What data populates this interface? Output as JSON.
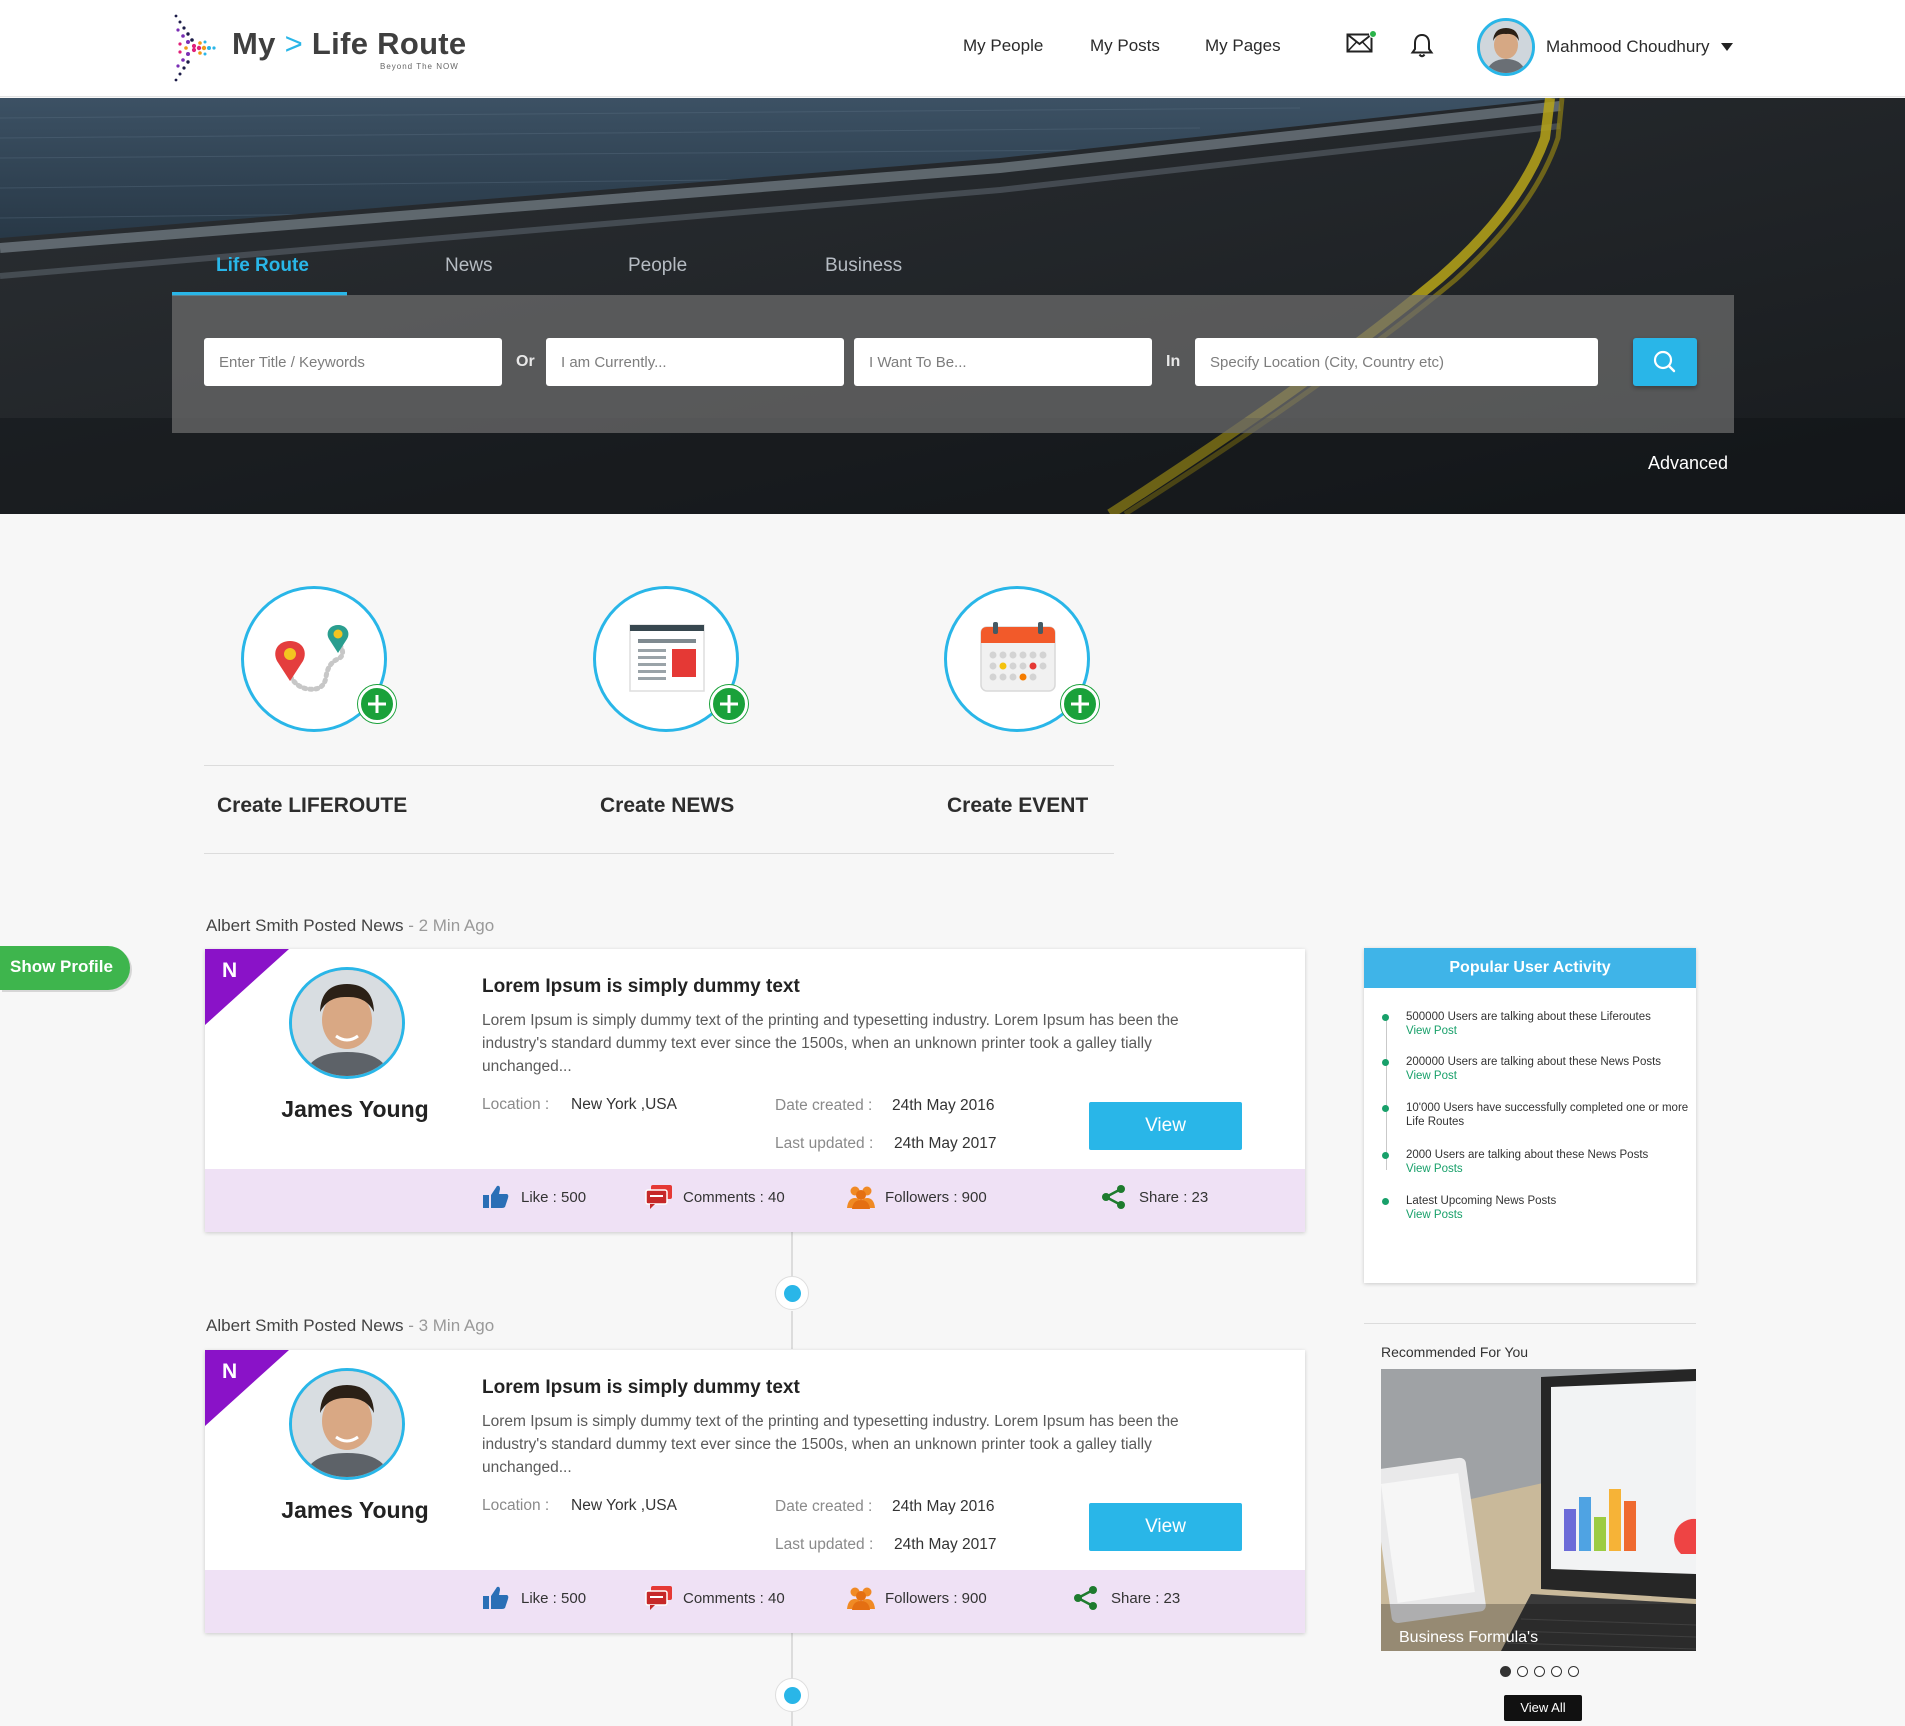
{
  "header": {
    "logo_my": "My",
    "logo_chevron": ">",
    "logo_route": "Life Route",
    "logo_tagline": "Beyond The NOW",
    "nav": [
      "My People",
      "My Posts",
      "My Pages"
    ],
    "user_name": "Mahmood Choudhury",
    "icons": [
      "mail-icon",
      "bell-icon"
    ]
  },
  "hero": {
    "tabs": [
      "Life Route",
      "News",
      "People",
      "Business"
    ],
    "active_tab": "Life Route",
    "search": {
      "keywords_placeholder": "Enter Title / Keywords",
      "or_label": "Or",
      "currently_placeholder": "I am Currently...",
      "want_placeholder": "I Want To Be...",
      "in_label": "In",
      "location_placeholder": "Specify Location (City, Country etc)"
    },
    "advanced_label": "Advanced"
  },
  "create": [
    {
      "label": "Create LIFEROUTE",
      "icon": "route-map-icon"
    },
    {
      "label": "Create NEWS",
      "icon": "newspaper-icon"
    },
    {
      "label": "Create EVENT",
      "icon": "calendar-icon"
    }
  ],
  "show_profile_label": "Show Profile",
  "posts": [
    {
      "author_line": "Albert Smith Posted News",
      "separator": " - ",
      "ago": "2 Min Ago",
      "badge": "N",
      "person_name": "James Young",
      "title": "Lorem Ipsum is simply dummy text",
      "description": "Lorem Ipsum is simply dummy text of the printing and typesetting industry. Lorem Ipsum has been the industry's standard dummy text ever since the 1500s, when an unknown printer took a galley tially unchanged...",
      "location_label": "Location :",
      "location": "New York ,USA",
      "created_label": "Date created :",
      "created": "24th May 2016",
      "updated_label": "Last updated :",
      "updated": "24th May 2017",
      "view_label": "View",
      "stats": {
        "like": "Like : 500",
        "comments": "Comments : 40",
        "followers": "Followers : 900",
        "share": "Share : 23"
      }
    },
    {
      "author_line": "Albert Smith Posted News",
      "separator": " - ",
      "ago": "3 Min Ago",
      "badge": "N",
      "person_name": "James Young",
      "title": "Lorem Ipsum is simply dummy text",
      "description": "Lorem Ipsum is simply dummy text of the printing and typesetting industry. Lorem Ipsum has been the industry's standard dummy text ever since the 1500s, when an unknown printer took a galley tially unchanged...",
      "location_label": "Location :",
      "location": "New York ,USA",
      "created_label": "Date created :",
      "created": "24th May 2016",
      "updated_label": "Last updated :",
      "updated": "24th May 2017",
      "view_label": "View",
      "stats": {
        "like": "Like : 500",
        "comments": "Comments : 40",
        "followers": "Followers : 900",
        "share": "Share : 23"
      }
    }
  ],
  "sidebar": {
    "popular_title": "Popular User Activity",
    "activities": [
      {
        "text": "500000 Users are talking about these Liferoutes",
        "link": "View Post"
      },
      {
        "text": "200000 Users are talking about these News Posts",
        "link": "View Post"
      },
      {
        "text": "10'000 Users have successfully completed one or more Life Routes",
        "link": ""
      },
      {
        "text": "2000 Users are talking about these News Posts",
        "link": "View Posts"
      },
      {
        "text": "Latest Upcoming News Posts",
        "link": "View Posts"
      }
    ],
    "recommended_title": "Recommended For You",
    "recommended_caption": "Business Formula's",
    "carousel_dots": 5,
    "carousel_active": 0,
    "view_all_label": "View All"
  },
  "colors": {
    "accent": "#29b6e8",
    "plus_green": "#1aa13a",
    "ribbon_purple": "#8a12c8",
    "footer_lavender": "#efe1f5",
    "link_green": "#18a06a",
    "profile_green": "#3eb54d"
  }
}
